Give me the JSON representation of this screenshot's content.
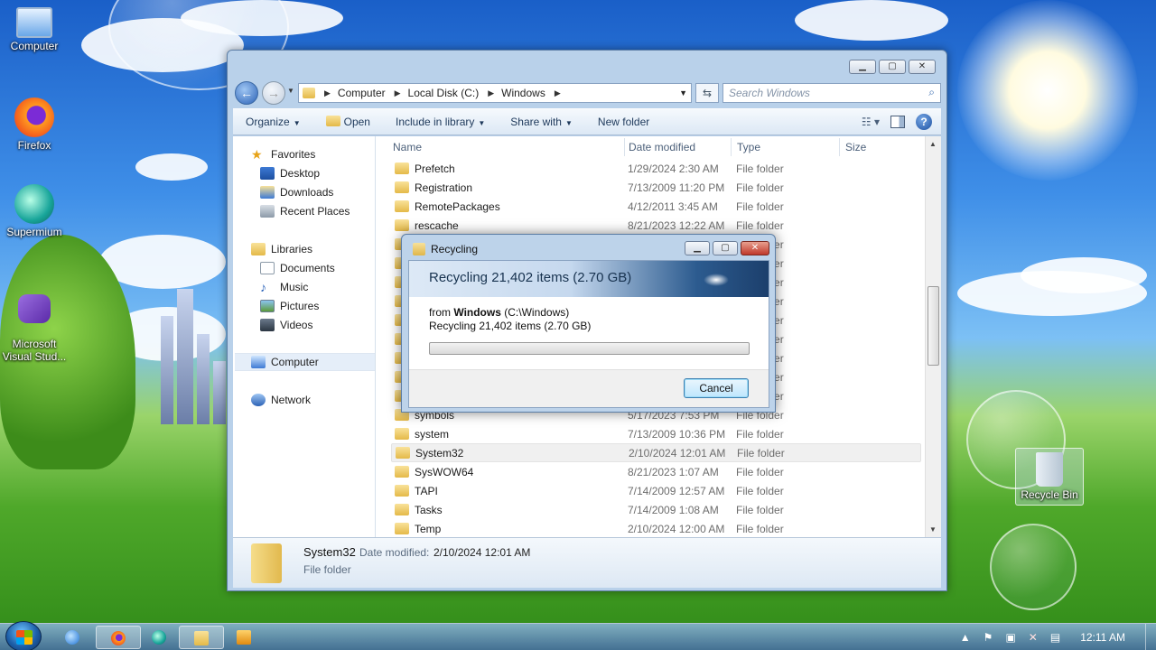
{
  "desktop": {
    "icons": [
      {
        "label": "Computer",
        "icon": "computer-icon",
        "color": "#cfe6ff"
      },
      {
        "label": "Firefox",
        "icon": "firefox-icon",
        "color": "#ff7a1a"
      },
      {
        "label": "Supermium",
        "icon": "supermium-icon",
        "color": "#17a39a"
      },
      {
        "label": "Microsoft\nVisual Stud...",
        "icon": "visual-studio-icon",
        "color": "#6b3fb0"
      },
      {
        "label": "Recycle Bin",
        "icon": "recycle-bin-icon",
        "color": "#dfe8ef"
      }
    ]
  },
  "explorer": {
    "address": {
      "segments": [
        "Computer",
        "Local Disk (C:)",
        "Windows"
      ],
      "search_placeholder": "Search Windows"
    },
    "toolbar": {
      "organize": "Organize",
      "open": "Open",
      "include_in_library": "Include in library",
      "share_with": "Share with",
      "new_folder": "New folder"
    },
    "nav": {
      "favorites": "Favorites",
      "desktop": "Desktop",
      "downloads": "Downloads",
      "recent_places": "Recent Places",
      "libraries": "Libraries",
      "documents": "Documents",
      "music": "Music",
      "pictures": "Pictures",
      "videos": "Videos",
      "computer": "Computer",
      "network": "Network"
    },
    "columns": {
      "name": "Name",
      "date": "Date modified",
      "type": "Type",
      "size": "Size"
    },
    "rows": [
      {
        "name": "Prefetch",
        "date": "1/29/2024 2:30 AM",
        "type": "File folder"
      },
      {
        "name": "Registration",
        "date": "7/13/2009 11:20 PM",
        "type": "File folder"
      },
      {
        "name": "RemotePackages",
        "date": "4/12/2011 3:45 AM",
        "type": "File folder"
      },
      {
        "name": "rescache",
        "date": "8/21/2023 12:22 AM",
        "type": "File folder"
      },
      {
        "name": "",
        "date": "",
        "type": "File folder"
      },
      {
        "name": "",
        "date": "",
        "type": "File folder"
      },
      {
        "name": "",
        "date": "",
        "type": "File folder"
      },
      {
        "name": "",
        "date": "",
        "type": "File folder"
      },
      {
        "name": "",
        "date": "",
        "type": "File folder"
      },
      {
        "name": "",
        "date": "",
        "type": "File folder"
      },
      {
        "name": "",
        "date": "",
        "type": "File folder"
      },
      {
        "name": "",
        "date": "",
        "type": "File folder"
      },
      {
        "name": "",
        "date": "",
        "type": "File folder"
      },
      {
        "name": "symbols",
        "date": "5/17/2023 7:53 PM",
        "type": "File folder"
      },
      {
        "name": "system",
        "date": "7/13/2009 10:36 PM",
        "type": "File folder"
      },
      {
        "name": "System32",
        "date": "2/10/2024 12:01 AM",
        "type": "File folder"
      },
      {
        "name": "SysWOW64",
        "date": "8/21/2023 1:07 AM",
        "type": "File folder"
      },
      {
        "name": "TAPI",
        "date": "7/14/2009 12:57 AM",
        "type": "File folder"
      },
      {
        "name": "Tasks",
        "date": "7/14/2009 1:08 AM",
        "type": "File folder"
      },
      {
        "name": "Temp",
        "date": "2/10/2024 12:00 AM",
        "type": "File folder"
      }
    ],
    "details": {
      "name": "System32",
      "date_label": "Date modified:",
      "date_value": "2/10/2024 12:01 AM",
      "type": "File folder"
    }
  },
  "dialog": {
    "title": "Recycling",
    "heading": "Recycling 21,402 items (2.70 GB)",
    "from_prefix": "from",
    "from_name": "Windows",
    "from_path": "(C:\\Windows)",
    "status": "Recycling 21,402 items (2.70 GB)",
    "progress": 0,
    "cancel": "Cancel"
  },
  "taskbar": {
    "clock": "12:11 AM",
    "apps": [
      "internet-explorer-icon",
      "firefox-icon",
      "supermium-icon",
      "explorer-icon",
      "media-player-icon"
    ]
  }
}
